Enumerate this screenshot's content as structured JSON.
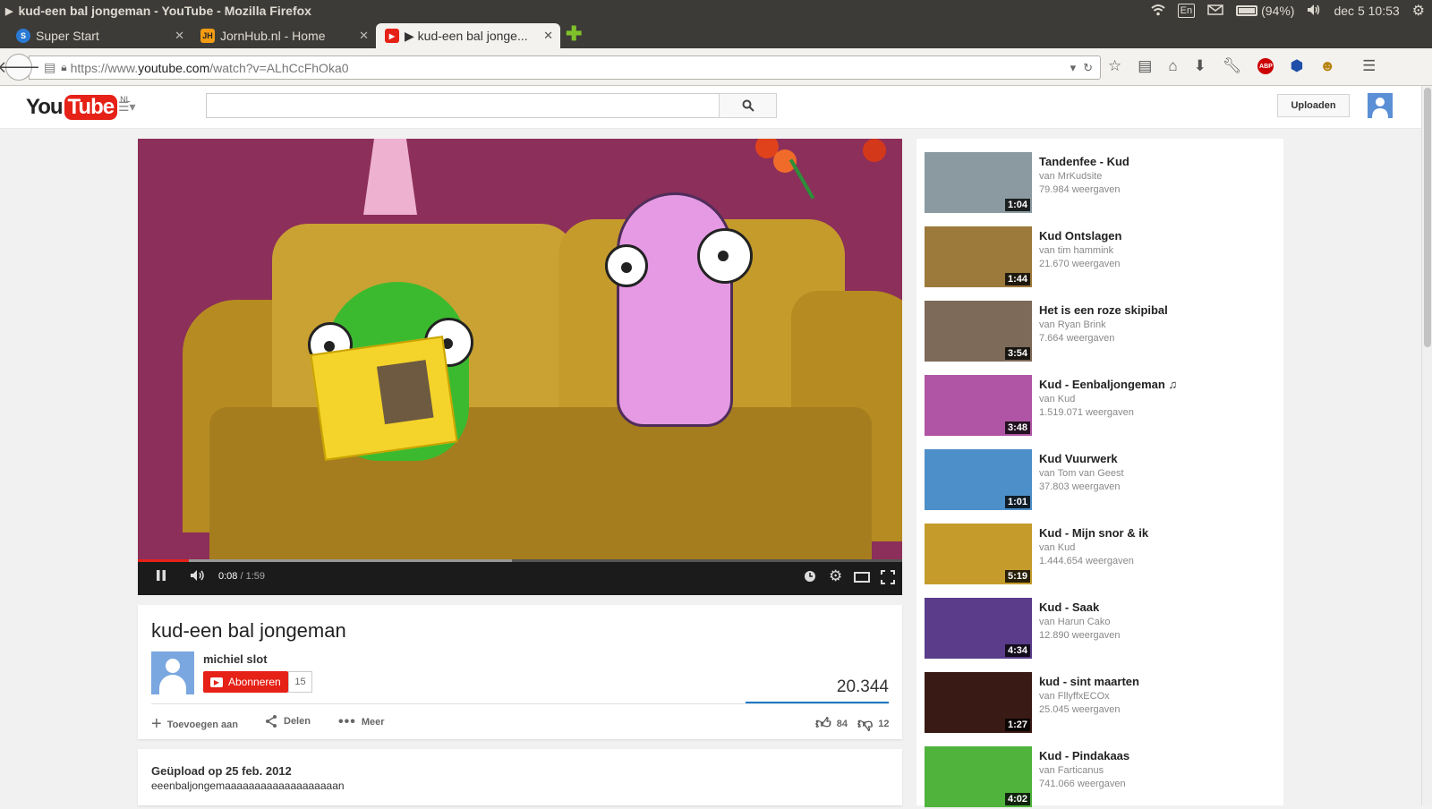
{
  "system_panel": {
    "window_title": "kud-een bal jongeman - YouTube - Mozilla Firefox",
    "keyboard": "En",
    "battery": "(94%)",
    "clock": "dec 5 10:53"
  },
  "tabs": [
    {
      "label": "Super Start",
      "icon": "super-start-icon",
      "color": "#2a7ad5"
    },
    {
      "label": "JornHub.nl - Home",
      "icon": "jornhub-icon",
      "color": "#f39c12"
    },
    {
      "label": "▶ kud-een bal jonge...",
      "icon": "youtube-icon",
      "color": "#e62117"
    }
  ],
  "navbar": {
    "url_prefix": "https://www.",
    "url_domain": "youtube.com",
    "url_path": "/watch?v=ALhCcFhOka0"
  },
  "youtube": {
    "logo_you": "You",
    "logo_tube": "Tube",
    "logo_region": "NL",
    "search_placeholder": "",
    "upload_label": "Uploaden",
    "accent": "#e62117"
  },
  "player": {
    "current_time": "0:08",
    "duration": " / 1:59",
    "played_fraction": 0.067,
    "buffered_fraction": 0.49
  },
  "video": {
    "title": "kud-een bal jongeman",
    "channel": "michiel slot",
    "subscribe_label": "Abonneren",
    "subscriber_count": "15",
    "views": "20.344",
    "add_to_label": "Toevoegen aan",
    "share_label": "Delen",
    "more_label": "Meer",
    "likes": "84",
    "dislikes": "12"
  },
  "description": {
    "uploaded": "Geüpload op 25 feb. 2012",
    "text": "eeenbaljongemaaaaaaaaaaaaaaaaaaan"
  },
  "related": [
    {
      "title": "Tandenfee - Kud",
      "by": "van MrKudsite",
      "views": "79.984 weergaven",
      "duration": "1:04",
      "thumb_color": "#8a9aa0"
    },
    {
      "title": "Kud Ontslagen",
      "by": "van tim hammink",
      "views": "21.670 weergaven",
      "duration": "1:44",
      "thumb_color": "#9c7a3c"
    },
    {
      "title": "Het is een roze skipibal",
      "by": "van Ryan Brink",
      "views": "7.664 weergaven",
      "duration": "3:54",
      "thumb_color": "#7d6a58"
    },
    {
      "title": "Kud - Eenbaljongeman ♫",
      "by": "van Kud",
      "views": "1.519.071 weergaven",
      "duration": "3:48",
      "thumb_color": "#b055a5"
    },
    {
      "title": "Kud Vuurwerk",
      "by": "van Tom van Geest",
      "views": "37.803 weergaven",
      "duration": "1:01",
      "thumb_color": "#4d8fc9"
    },
    {
      "title": "Kud - Mijn snor & ik",
      "by": "van Kud",
      "views": "1.444.654 weergaven",
      "duration": "5:19",
      "thumb_color": "#c59b2c"
    },
    {
      "title": "Kud - Saak",
      "by": "van Harun Cako",
      "views": "12.890 weergaven",
      "duration": "4:34",
      "thumb_color": "#5a3c8a"
    },
    {
      "title": "kud - sint maarten",
      "by": "van FllyffxECOx",
      "views": "25.045 weergaven",
      "duration": "1:27",
      "thumb_color": "#3a1a14"
    },
    {
      "title": "Kud - Pindakaas",
      "by": "van Farticanus",
      "views": "741.066 weergaven",
      "duration": "4:02",
      "thumb_color": "#4fb33c"
    }
  ]
}
